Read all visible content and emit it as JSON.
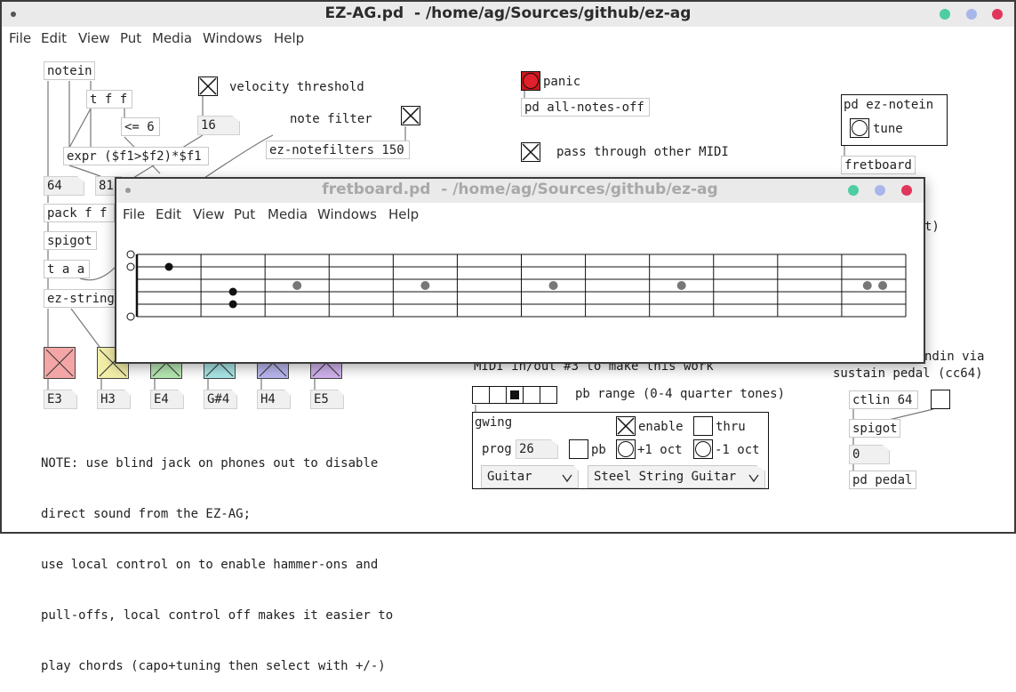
{
  "main_window": {
    "title": "EZ-AG.pd  - /home/ag/Sources/github/ez-ag",
    "menu": [
      "File",
      "Edit",
      "View",
      "Put",
      "Media",
      "Windows",
      "Help"
    ]
  },
  "fret_window": {
    "title": "fretboard.pd  - /home/ag/Sources/github/ez-ag",
    "menu": [
      "File",
      "Edit",
      "View",
      "Put",
      "Media",
      "Windows",
      "Help"
    ]
  },
  "traffic_colors": {
    "green": "#4ecca3",
    "blue": "#a9b6ea",
    "red": "#e0365c"
  },
  "objects": {
    "notein": "notein",
    "tff": "t f f",
    "le6": "<= 6",
    "expr": "expr ($f1>$f2)*$f1",
    "packff": "pack f f",
    "spigot": "spigot",
    "taa": "t a a",
    "ezstring": "ez-string",
    "notefilters": "ez-notefilters 150",
    "allnotesoff": "pd all-notes-off",
    "eznotein": "pd ez-notein",
    "fretboard": "fretboard",
    "ctlin": "ctlin 64",
    "spigot2": "spigot",
    "pdpedal": "pd pedal"
  },
  "numbers": {
    "vel": "16",
    "n64": "64",
    "n81": "81",
    "prog": "26",
    "zero": "0"
  },
  "labels": {
    "velocity": "velocity threshold",
    "notefilter": "note filter",
    "panic": "panic",
    "passthrough": "pass through other MIDI",
    "tune": "tune",
    "tunepartial": "t)",
    "sustain1": "ndin via",
    "sustain2": "sustain pedal (cc64)",
    "midiout": "MIDI in/out #3 to make this work",
    "pbrange": "pb range (0-4 quarter tones)",
    "gwing": "gwing",
    "prog": "prog",
    "enable": "enable",
    "thru": "thru",
    "pb": "pb",
    "plus1oct": "+1 oct",
    "minus1oct": "-1 oct",
    "note_lines": [
      "NOTE: use blind jack on phones out to disable",
      "direct sound from the EZ-AG;",
      "use local control on to enable hammer-ons and",
      "pull-offs, local control off makes it easier to",
      "play chords (capo+tuning then select with +/-)"
    ]
  },
  "strings": [
    {
      "label": "E3",
      "color": "#f4a6a6"
    },
    {
      "label": "H3",
      "color": "#f3efa8"
    },
    {
      "label": "E4",
      "color": "#b6e8b2"
    },
    {
      "label": "G#4",
      "color": "#a9e6e6"
    },
    {
      "label": "H4",
      "color": "#b9b6ee"
    },
    {
      "label": "E5",
      "color": "#d2b2ee"
    }
  ],
  "dropdowns": {
    "instrument": "Guitar",
    "sound": "Steel String Guitar"
  },
  "pb_range_selected": 2,
  "fretboard": {
    "frets": 12,
    "strings": 6
  }
}
